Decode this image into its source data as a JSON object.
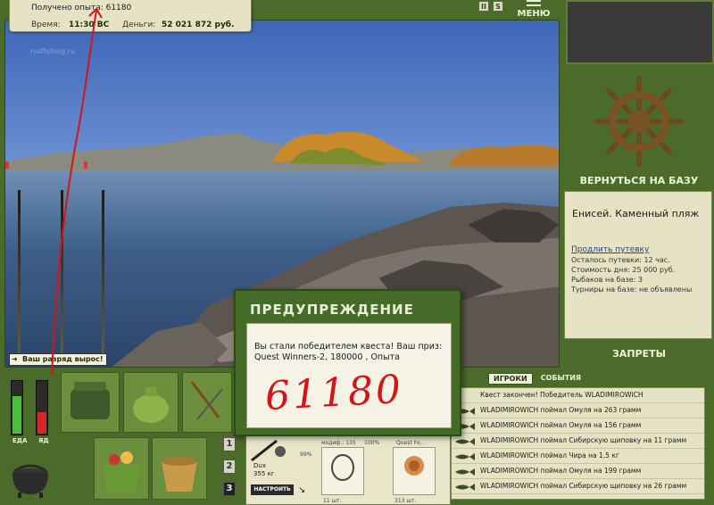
{
  "info_panel": {
    "experience": "Получено опыта: 61180",
    "time_label": "Время:",
    "time_value": "11:30 ВС",
    "money_label": "Деньги:",
    "money_value": "52 021 872 руб."
  },
  "top_bar": {
    "pause_icon": "II",
    "s_icon": "S",
    "menu_label": "МЕНЮ"
  },
  "right_panel": {
    "return_label": "ВЕРНУТЬСЯ НА БАЗУ",
    "location_title": "Енисей. Каменный пляж",
    "extend_link": "Продлить путевку",
    "lines": [
      "Осталось путевки: 12 час.",
      "Стоимость дня: 25 000 руб.",
      "Рыбаков на базе: 3",
      "Турниры на базе: не объявлены"
    ],
    "bans_label": "ЗАПРЕТЫ"
  },
  "events": {
    "tabs": [
      {
        "label": "ИГРОКИ",
        "active": true
      },
      {
        "label": "СОБЫТИЯ",
        "active": false
      }
    ],
    "items": [
      "Квест закончен! Победитель WLADIMIROWICH",
      "WLADIMIROWICH поймал Омуля на 263 грамм",
      "WLADIMIROWICH поймал Омуля на 156 грамм",
      "WLADIMIROWICH поймал Сибирскую щиповку на 11 грамм",
      "WLADIMIROWICH поймал Чира на 1,5 кг",
      "WLADIMIROWICH поймал Омуля на 199 грамм",
      "WLADIMIROWICH поймал Сибирскую щиповку на 26 грамм"
    ]
  },
  "rank_banner": "Ваш разряд вырос!",
  "status_bars": {
    "food_label": "ЕДА",
    "poison_label": "ЯД",
    "food_level": 0.7,
    "poison_level": 0.4,
    "food_color": "#4bbd3a",
    "poison_color": "#d92626"
  },
  "slot_numbers": [
    {
      "label": "1",
      "active": false
    },
    {
      "label": "2",
      "active": false
    },
    {
      "label": "3",
      "active": true
    }
  ],
  "gear": {
    "rod_name_line1": "Dux",
    "rod_name_line2": "355 кг",
    "setup_button": "НАСТРОИТЬ",
    "percent": "99%",
    "mod_label": "модиф.: 135",
    "mod_percent": "100%",
    "quest_label": "Quest Fo...",
    "hook_count": "11 шт.",
    "bait_count": "313 шт."
  },
  "dialog": {
    "title": "ПРЕДУПРЕЖДЕНИЕ",
    "message": "Вы стали победителем квеста! Ваш приз: Quest Winners-2, 180000 , Опыта",
    "handwritten": "61180"
  },
  "colors": {
    "panel_green": "#4a6b2a",
    "panel_cream": "#e6e3c4",
    "annotation_red": "#d4141a"
  }
}
